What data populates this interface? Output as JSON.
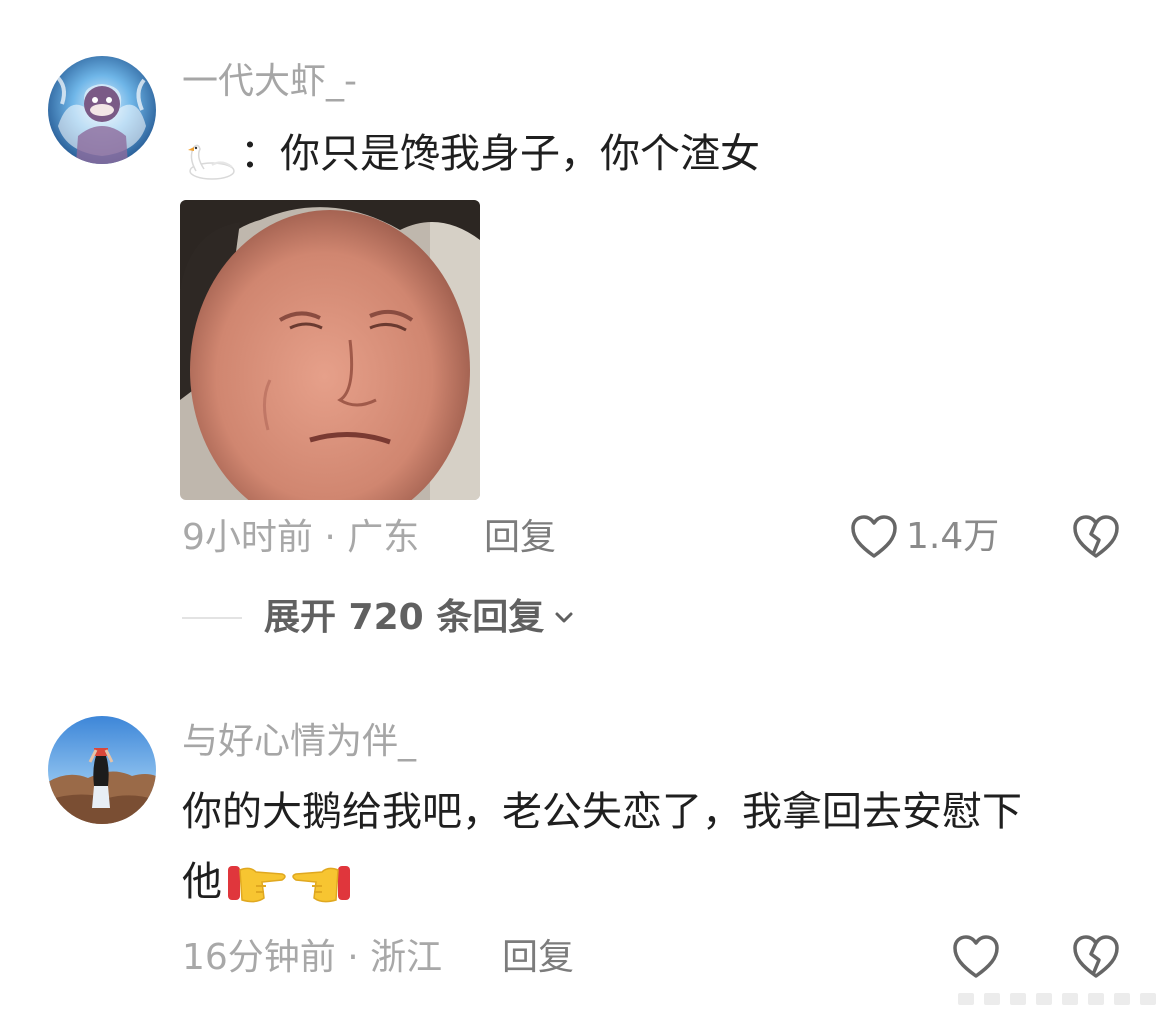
{
  "comments": [
    {
      "username": "一代大虾_-",
      "text_prefix": "：你只是馋我身子，你个渣女",
      "emoji_prefix": "swan-emoji",
      "image": "crying-man-meme",
      "time_location": "9小时前 · 广东",
      "reply_label": "回复",
      "likes": "1.4万",
      "expand_label": "展开 720 条回复"
    },
    {
      "username": "与好心情为伴_",
      "text_line1": "你的大鹅给我吧，老公失恋了，我拿回去安慰下",
      "text_line2": "他",
      "emojis_after": [
        "pointing-right-emoji",
        "pointing-left-emoji"
      ],
      "time_location": "16分钟前 · 浙江",
      "reply_label": "回复",
      "likes": ""
    }
  ],
  "colors": {
    "username": "#a6a6a6",
    "meta": "#a8a8a8",
    "text": "#1f1f1f",
    "expand": "#606060"
  }
}
